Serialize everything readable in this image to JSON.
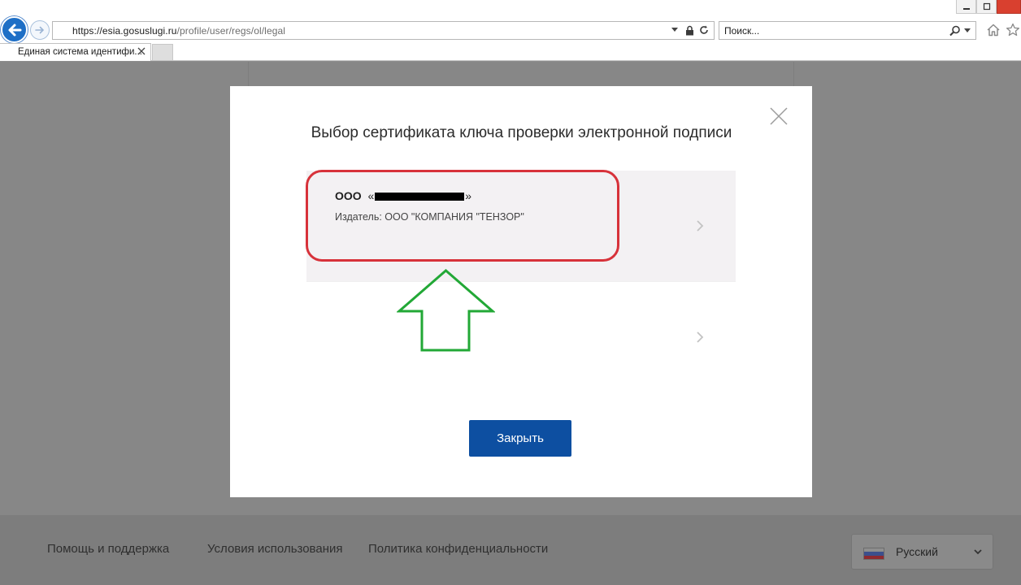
{
  "browser": {
    "url_prefix": "https://",
    "url_host": "esia.gosuslugi.ru",
    "url_path": "/profile/user/regs/ol/legal",
    "search_placeholder": "Поиск...",
    "tab_title": "Единая система идентифи...",
    "icons": [
      "back-icon",
      "forward-icon",
      "dropdown-icon",
      "lock-icon",
      "refresh-icon",
      "search-icon",
      "home-icon",
      "star-icon",
      "minimize-icon",
      "maximize-icon",
      "close-icon"
    ]
  },
  "modal": {
    "title": "Выбор сертификата ключа проверки электронной подписи",
    "certificates": [
      {
        "name_prefix": "ООО",
        "name_open_quote": "«",
        "name_close_quote": "»",
        "issuer": "Издатель: ООО \"КОМПАНИЯ \"ТЕНЗОР\""
      }
    ],
    "close_button": "Закрыть"
  },
  "footer": {
    "links": [
      "Помощь и поддержка",
      "Условия использования",
      "Политика конфиденциальности"
    ],
    "language": "Русский"
  },
  "colors": {
    "primary_button": "#0d4fa1",
    "highlight": "#d7323a",
    "arrow": "#22a836",
    "overlay": "#878787"
  }
}
